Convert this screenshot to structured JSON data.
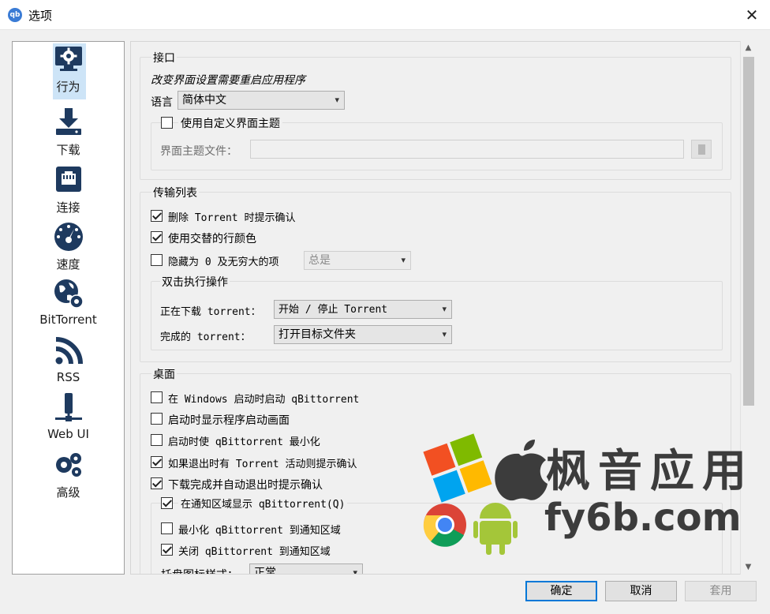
{
  "window": {
    "title": "选项",
    "app_icon_text": "qb"
  },
  "sidebar": {
    "items": [
      {
        "label": "行为",
        "icon": "monitor-gear-icon",
        "selected": true
      },
      {
        "label": "下载",
        "icon": "download-icon",
        "selected": false
      },
      {
        "label": "连接",
        "icon": "network-port-icon",
        "selected": false
      },
      {
        "label": "速度",
        "icon": "speedometer-icon",
        "selected": false
      },
      {
        "label": "BitTorrent",
        "icon": "globe-gear-icon",
        "selected": false
      },
      {
        "label": "RSS",
        "icon": "rss-icon",
        "selected": false
      },
      {
        "label": "Web UI",
        "icon": "webui-network-icon",
        "selected": false
      },
      {
        "label": "高级",
        "icon": "gears-icon",
        "selected": false
      }
    ]
  },
  "interface": {
    "title": "接口",
    "restart_note": "改变界面设置需要重启应用程序",
    "language_label": "语言",
    "language_value": "简体中文",
    "custom_theme_label": "使用自定义界面主题",
    "custom_theme_checked": false,
    "theme_file_label": "界面主题文件："
  },
  "transfer_list": {
    "title": "传输列表",
    "confirm_delete_label": "删除 Torrent 时提示确认",
    "confirm_delete_checked": true,
    "alt_row_colors_label": "使用交替的行颜色",
    "alt_row_colors_checked": true,
    "hide_zero_label": "隐藏为 0 及无穷大的项",
    "hide_zero_checked": false,
    "hide_zero_value": "总是",
    "double_click": {
      "title": "双击执行操作",
      "downloading_label": "正在下载 torrent：",
      "downloading_value": "开始 / 停止 Torrent",
      "completed_label": "完成的 torrent：",
      "completed_value": "打开目标文件夹"
    }
  },
  "desktop": {
    "title": "桌面",
    "items": [
      {
        "label": "在 Windows 启动时启动 qBittorrent",
        "checked": false
      },
      {
        "label": "启动时显示程序启动画面",
        "checked": false
      },
      {
        "label": "启动时使 qBittorrent 最小化",
        "checked": false
      },
      {
        "label": "如果退出时有 Torrent 活动则提示确认",
        "checked": true
      },
      {
        "label": "下载完成并自动退出时提示确认",
        "checked": true
      }
    ],
    "tray_label": "在通知区域显示 qBittorrent(Q)",
    "tray_checked": true,
    "tray_items": [
      {
        "label": "最小化 qBittorrent 到通知区域",
        "checked": false
      },
      {
        "label": "关闭 qBittorrent 到通知区域",
        "checked": true
      }
    ],
    "tray_icon_style_label": "托盘图标样式：",
    "tray_icon_style_value": "正常"
  },
  "buttons": {
    "ok": "确定",
    "cancel": "取消",
    "apply": "套用"
  },
  "watermark": {
    "line1": "枫音应用",
    "line2": "fy6b.com"
  },
  "colors": {
    "accent": "#0078d7",
    "selection": "#cde4f7",
    "icon": "#1e3a5f"
  }
}
